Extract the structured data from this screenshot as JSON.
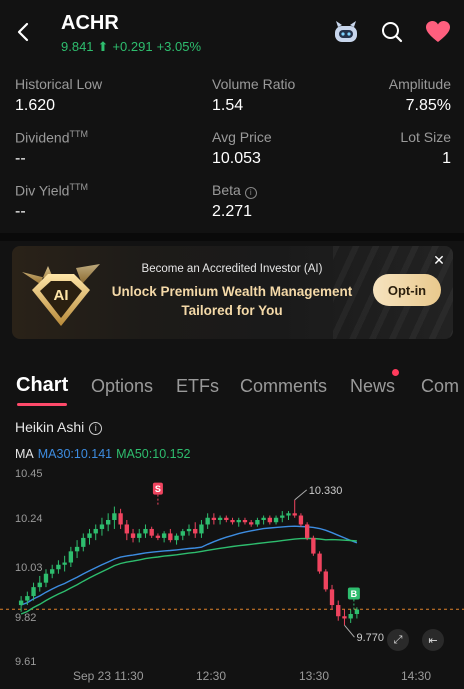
{
  "header": {
    "ticker": "ACHR",
    "price": "9.841",
    "change": "+0.291",
    "change_pct": "+3.05%",
    "up_color": "#2ebd6e",
    "icons": [
      "back-icon",
      "robot-icon",
      "search-icon",
      "heart-icon"
    ]
  },
  "stats": [
    {
      "label": "Historical Low",
      "value": "1.620"
    },
    {
      "label": "Volume Ratio",
      "value": "1.54"
    },
    {
      "label": "Amplitude",
      "value": "7.85%"
    },
    {
      "label": "Dividend",
      "sup": "TTM",
      "value": "--"
    },
    {
      "label": "Avg Price",
      "value": "10.053"
    },
    {
      "label": "Lot Size",
      "value": "1"
    },
    {
      "label": "Div Yield",
      "sup": "TTM",
      "value": "--"
    },
    {
      "label": "Beta",
      "value": "2.271"
    }
  ],
  "banner": {
    "badge_text": "AI",
    "subtitle": "Become an Accredited Investor (AI)",
    "title_line1": "Unlock Premium Wealth Management",
    "title_line2": "Tailored for You",
    "cta": "Opt-in",
    "close": "✕"
  },
  "tabs": [
    "Chart",
    "Options",
    "ETFs",
    "Comments",
    "News",
    "Com"
  ],
  "chart_header": {
    "type_label": "Heikin Ashi",
    "ma_label": "MA",
    "ma30": "MA30:10.141",
    "ma50": "MA50:10.152",
    "ma30_color": "#3d8ce0",
    "ma50_color": "#2ebd6e"
  },
  "chart_data": {
    "type": "candlestick",
    "y_ticks": [
      "10.45",
      "10.24",
      "10.03",
      "9.82",
      "9.61"
    ],
    "x_ticks": [
      "Sep 23 11:30",
      "12:30",
      "13:30",
      "14:30"
    ],
    "ylim": [
      9.61,
      10.45
    ],
    "annotations": {
      "high": "10.330",
      "low": "9.770",
      "sell_marker": "S",
      "buy_marker": "B"
    },
    "reference_line": 9.841,
    "candles": [
      [
        9.86,
        9.9,
        9.83,
        9.88
      ],
      [
        9.88,
        9.92,
        9.86,
        9.9
      ],
      [
        9.9,
        9.96,
        9.88,
        9.94
      ],
      [
        9.94,
        9.99,
        9.92,
        9.96
      ],
      [
        9.96,
        10.02,
        9.94,
        10.0
      ],
      [
        10.0,
        10.04,
        9.98,
        10.02
      ],
      [
        10.02,
        10.06,
        10.0,
        10.04
      ],
      [
        10.04,
        10.08,
        10.01,
        10.05
      ],
      [
        10.05,
        10.12,
        10.03,
        10.1
      ],
      [
        10.1,
        10.15,
        10.07,
        10.12
      ],
      [
        10.12,
        10.18,
        10.1,
        10.16
      ],
      [
        10.16,
        10.2,
        10.13,
        10.18
      ],
      [
        10.18,
        10.22,
        10.15,
        10.2
      ],
      [
        10.2,
        10.25,
        10.17,
        10.22
      ],
      [
        10.22,
        10.27,
        10.19,
        10.24
      ],
      [
        10.24,
        10.3,
        10.2,
        10.27
      ],
      [
        10.27,
        10.29,
        10.2,
        10.22
      ],
      [
        10.22,
        10.24,
        10.15,
        10.18
      ],
      [
        10.18,
        10.2,
        10.14,
        10.16
      ],
      [
        10.16,
        10.2,
        10.14,
        10.18
      ],
      [
        10.18,
        10.22,
        10.16,
        10.2
      ],
      [
        10.2,
        10.21,
        10.16,
        10.17
      ],
      [
        10.17,
        10.18,
        10.15,
        10.16
      ],
      [
        10.16,
        10.19,
        10.14,
        10.18
      ],
      [
        10.18,
        10.2,
        10.14,
        10.15
      ],
      [
        10.15,
        10.18,
        10.13,
        10.17
      ],
      [
        10.17,
        10.2,
        10.15,
        10.19
      ],
      [
        10.19,
        10.22,
        10.17,
        10.2
      ],
      [
        10.2,
        10.23,
        10.16,
        10.18
      ],
      [
        10.18,
        10.24,
        10.16,
        10.22
      ],
      [
        10.22,
        10.27,
        10.2,
        10.25
      ],
      [
        10.25,
        10.27,
        10.22,
        10.24
      ],
      [
        10.24,
        10.26,
        10.22,
        10.25
      ],
      [
        10.25,
        10.26,
        10.23,
        10.24
      ],
      [
        10.24,
        10.25,
        10.22,
        10.23
      ],
      [
        10.23,
        10.25,
        10.21,
        10.24
      ],
      [
        10.24,
        10.25,
        10.22,
        10.23
      ],
      [
        10.23,
        10.24,
        10.21,
        10.22
      ],
      [
        10.22,
        10.25,
        10.21,
        10.24
      ],
      [
        10.24,
        10.26,
        10.22,
        10.25
      ],
      [
        10.25,
        10.26,
        10.22,
        10.23
      ],
      [
        10.23,
        10.26,
        10.22,
        10.25
      ],
      [
        10.25,
        10.28,
        10.23,
        10.26
      ],
      [
        10.26,
        10.28,
        10.24,
        10.27
      ],
      [
        10.27,
        10.33,
        10.25,
        10.26
      ],
      [
        10.26,
        10.27,
        10.21,
        10.22
      ],
      [
        10.22,
        10.23,
        10.15,
        10.16
      ],
      [
        10.16,
        10.17,
        10.08,
        10.09
      ],
      [
        10.09,
        10.1,
        10.0,
        10.01
      ],
      [
        10.01,
        10.02,
        9.92,
        9.93
      ],
      [
        9.93,
        9.95,
        9.84,
        9.86
      ],
      [
        9.86,
        9.88,
        9.79,
        9.81
      ],
      [
        9.81,
        9.84,
        9.77,
        9.8
      ],
      [
        9.8,
        9.84,
        9.78,
        9.82
      ],
      [
        9.82,
        9.85,
        9.8,
        9.84
      ]
    ]
  },
  "chart_controls": {
    "expand": "⤢",
    "collapse": "⇤"
  }
}
